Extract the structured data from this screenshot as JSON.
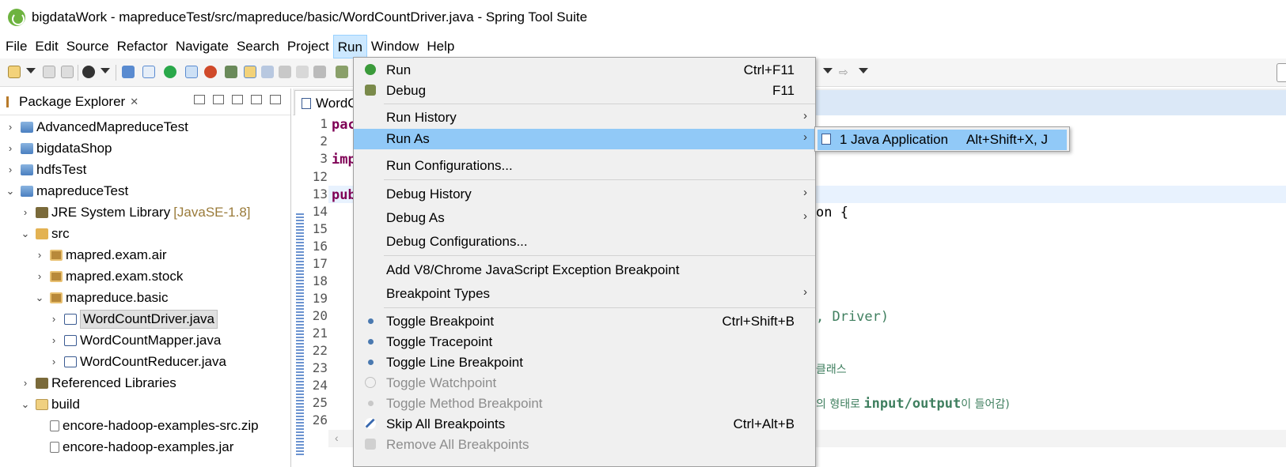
{
  "window": {
    "title": "bigdataWork - mapreduceTest/src/mapreduce/basic/WordCountDriver.java - Spring Tool Suite"
  },
  "menubar": [
    "File",
    "Edit",
    "Source",
    "Refactor",
    "Navigate",
    "Search",
    "Project",
    "Run",
    "Window",
    "Help"
  ],
  "package_explorer": {
    "title": "Package Explorer",
    "close": "✕",
    "tree": [
      {
        "label": "AdvancedMapreduceTest",
        "expanded": false
      },
      {
        "label": "bigdataShop",
        "expanded": false
      },
      {
        "label": "hdfsTest",
        "expanded": false
      },
      {
        "label": "mapreduceTest",
        "expanded": true
      },
      {
        "label": "JRE System Library",
        "suffix": "[JavaSE-1.8]",
        "expanded": false
      },
      {
        "label": "src",
        "expanded": true
      },
      {
        "label": "mapred.exam.air",
        "expanded": false
      },
      {
        "label": "mapred.exam.stock",
        "expanded": false
      },
      {
        "label": "mapreduce.basic",
        "expanded": true
      },
      {
        "label": "WordCountDriver.java",
        "selected": true
      },
      {
        "label": "WordCountMapper.java"
      },
      {
        "label": "WordCountReducer.java"
      },
      {
        "label": "Referenced Libraries",
        "expanded": false
      },
      {
        "label": "build",
        "expanded": true
      },
      {
        "label": "encore-hadoop-examples-src.zip"
      },
      {
        "label": "encore-hadoop-examples.jar"
      }
    ]
  },
  "editor": {
    "tab_label": "WordC",
    "line_numbers": [
      "1",
      "2",
      "3",
      "12",
      "13",
      "14",
      "15",
      "16",
      "17",
      "18",
      "19",
      "20",
      "21",
      "22",
      "23",
      "24",
      "25",
      "26"
    ],
    "code": {
      "l1": "pac",
      "l3": "imp",
      "l13": "pub",
      "l14_tail": "on {",
      "l20_tail": ", Driver)",
      "l23_tail": "클래스",
      "l25_pre": "의 형태로 ",
      "l25_code": "input/output",
      "l25_post": "이 들어감)"
    }
  },
  "run_menu": {
    "items": [
      {
        "label": "Run",
        "accelerator": "Ctrl+F11",
        "icon": "run-icon"
      },
      {
        "label": "Debug",
        "accelerator": "F11",
        "icon": "debug-icon"
      },
      {
        "label": "Run History",
        "submenu": true
      },
      {
        "label": "Run As",
        "submenu": true,
        "highlighted": true
      },
      {
        "label": "Run Configurations..."
      },
      {
        "label": "Debug History",
        "submenu": true
      },
      {
        "label": "Debug As",
        "submenu": true
      },
      {
        "label": "Debug Configurations..."
      },
      {
        "label": "Add V8/Chrome JavaScript Exception Breakpoint"
      },
      {
        "label": "Breakpoint Types",
        "submenu": true
      },
      {
        "label": "Toggle Breakpoint",
        "accelerator": "Ctrl+Shift+B",
        "icon": "breakpoint-dot-icon"
      },
      {
        "label": "Toggle Tracepoint",
        "icon": "tracepoint-dot-icon"
      },
      {
        "label": "Toggle Line Breakpoint",
        "icon": "line-breakpoint-dot-icon"
      },
      {
        "label": "Toggle Watchpoint",
        "disabled": true,
        "icon": "watchpoint-icon"
      },
      {
        "label": "Toggle Method Breakpoint",
        "disabled": true,
        "icon": "method-breakpoint-dot-icon"
      },
      {
        "label": "Skip All Breakpoints",
        "accelerator": "Ctrl+Alt+B",
        "icon": "skip-breakpoints-icon"
      },
      {
        "label": "Remove All Breakpoints",
        "disabled": true,
        "icon": "remove-breakpoints-icon"
      }
    ],
    "submenu_arrow": "›"
  },
  "run_as_submenu": {
    "label": "1 Java Application",
    "accelerator": "Alt+Shift+X, J"
  }
}
